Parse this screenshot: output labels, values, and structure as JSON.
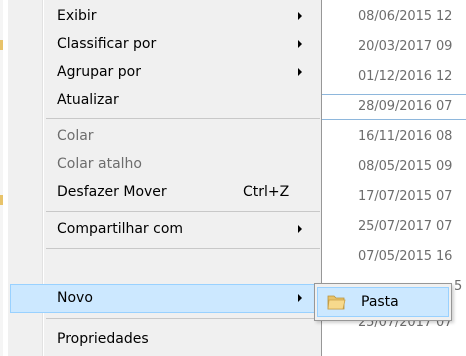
{
  "background_dates": [
    "08/06/2015 12",
    "20/03/2017 09",
    "01/12/2016 12",
    "28/09/2016 07",
    "16/11/2016 08",
    "08/05/2015 09",
    "17/07/2015 07",
    "25/07/2017 07",
    "07/05/2015 16",
    "5",
    "25/07/2017 07"
  ],
  "menu": {
    "items": [
      {
        "label": "Exibir",
        "submenu": true
      },
      {
        "label": "Classificar por",
        "submenu": true
      },
      {
        "label": "Agrupar por",
        "submenu": true
      },
      {
        "label": "Atualizar"
      },
      {
        "label": "Colar",
        "disabled": true
      },
      {
        "label": "Colar atalho",
        "disabled": true
      },
      {
        "label": "Desfazer Mover",
        "shortcut": "Ctrl+Z"
      },
      {
        "label": "Compartilhar com",
        "submenu": true
      },
      {
        "label": "Novo",
        "submenu": true,
        "selected": true
      },
      {
        "label": "Propriedades"
      }
    ]
  },
  "submenu": {
    "items": [
      {
        "label": "Pasta",
        "icon": "folder-icon"
      }
    ]
  },
  "colors": {
    "menu_bg": "#f0f0f0",
    "highlight_bg": "#cce8ff",
    "highlight_border": "#99d1ff",
    "disabled_text": "#6d6d6d",
    "folder": "#e8c36a"
  }
}
